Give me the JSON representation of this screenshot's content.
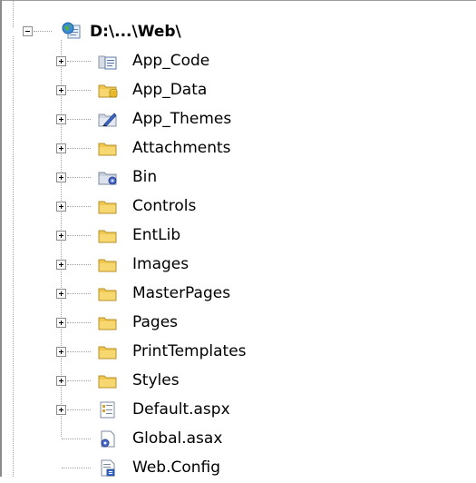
{
  "root": {
    "label": "D:\\...\\Web\\",
    "icon": "web-project-icon",
    "expanded": true
  },
  "items": [
    {
      "label": "App_Code",
      "icon": "app-code-folder-icon",
      "expandable": true
    },
    {
      "label": "App_Data",
      "icon": "app-data-folder-icon",
      "expandable": true
    },
    {
      "label": "App_Themes",
      "icon": "app-themes-folder-icon",
      "expandable": true
    },
    {
      "label": "Attachments",
      "icon": "folder-icon",
      "expandable": true
    },
    {
      "label": "Bin",
      "icon": "bin-folder-icon",
      "expandable": true
    },
    {
      "label": "Controls",
      "icon": "folder-icon",
      "expandable": true
    },
    {
      "label": "EntLib",
      "icon": "folder-icon",
      "expandable": true
    },
    {
      "label": "Images",
      "icon": "folder-icon",
      "expandable": true
    },
    {
      "label": "MasterPages",
      "icon": "folder-icon",
      "expandable": true
    },
    {
      "label": "Pages",
      "icon": "folder-icon",
      "expandable": true
    },
    {
      "label": "PrintTemplates",
      "icon": "folder-icon",
      "expandable": true
    },
    {
      "label": "Styles",
      "icon": "folder-icon",
      "expandable": true
    },
    {
      "label": "Default.aspx",
      "icon": "aspx-page-icon",
      "expandable": true
    },
    {
      "label": "Global.asax",
      "icon": "asax-file-icon",
      "expandable": false
    },
    {
      "label": "Web.Config",
      "icon": "config-file-icon",
      "expandable": false
    }
  ],
  "colors": {
    "folder": "#f0c850",
    "tree_lines": "#a0a0a0",
    "border": "#8a8a8a"
  }
}
